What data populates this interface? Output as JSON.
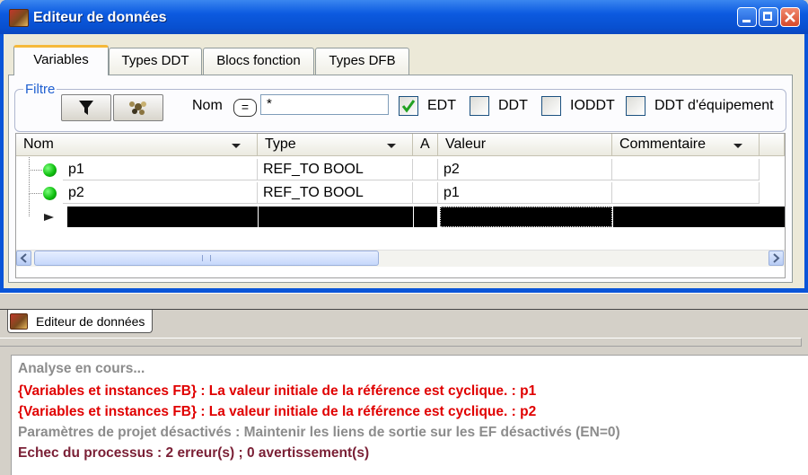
{
  "window": {
    "title": "Editeur de données"
  },
  "tabs": [
    {
      "label": "Variables",
      "active": true
    },
    {
      "label": "Types DDT",
      "active": false
    },
    {
      "label": "Blocs fonction",
      "active": false
    },
    {
      "label": "Types DFB",
      "active": false
    }
  ],
  "filter": {
    "group_label": "Filtre",
    "name_label": "Nom",
    "name_operator": "=",
    "name_value": "*",
    "checkboxes": [
      {
        "label": "EDT",
        "checked": true
      },
      {
        "label": "DDT",
        "checked": false
      },
      {
        "label": "IODDT",
        "checked": false
      },
      {
        "label": "DDT d'équipement",
        "checked": false
      }
    ]
  },
  "grid": {
    "columns": [
      "Nom",
      "Type",
      "A",
      "Valeur",
      "Commentaire"
    ],
    "rows": [
      {
        "name": "p1",
        "type": "REF_TO BOOL",
        "a": "",
        "value": "p2",
        "comment": ""
      },
      {
        "name": "p2",
        "type": "REF_TO BOOL",
        "a": "",
        "value": "p1",
        "comment": ""
      }
    ],
    "status_color": "#10c010"
  },
  "bottom_tab": {
    "label": "Editeur de données"
  },
  "output": {
    "lines": [
      {
        "text": "Analyse en cours...",
        "color": "#8c8c8c"
      },
      {
        "text": "{Variables et instances FB} : La valeur initiale de la référence est cyclique. : p1",
        "color": "#e00000"
      },
      {
        "text": "{Variables et instances FB} : La valeur initiale de la référence est cyclique. : p2",
        "color": "#e00000"
      },
      {
        "text": "Paramètres de projet désactivés : Maintenir les liens de sortie sur les EF désactivés (EN=0)",
        "color": "#8c8c8c"
      },
      {
        "text": "Echec du processus : 2 erreur(s) ; 0 avertissement(s)",
        "color": "#7a1f35"
      }
    ]
  },
  "colors": {
    "title_blue": "#0a55d8",
    "tab_highlight": "#f5b93a",
    "error_red": "#e00000"
  }
}
